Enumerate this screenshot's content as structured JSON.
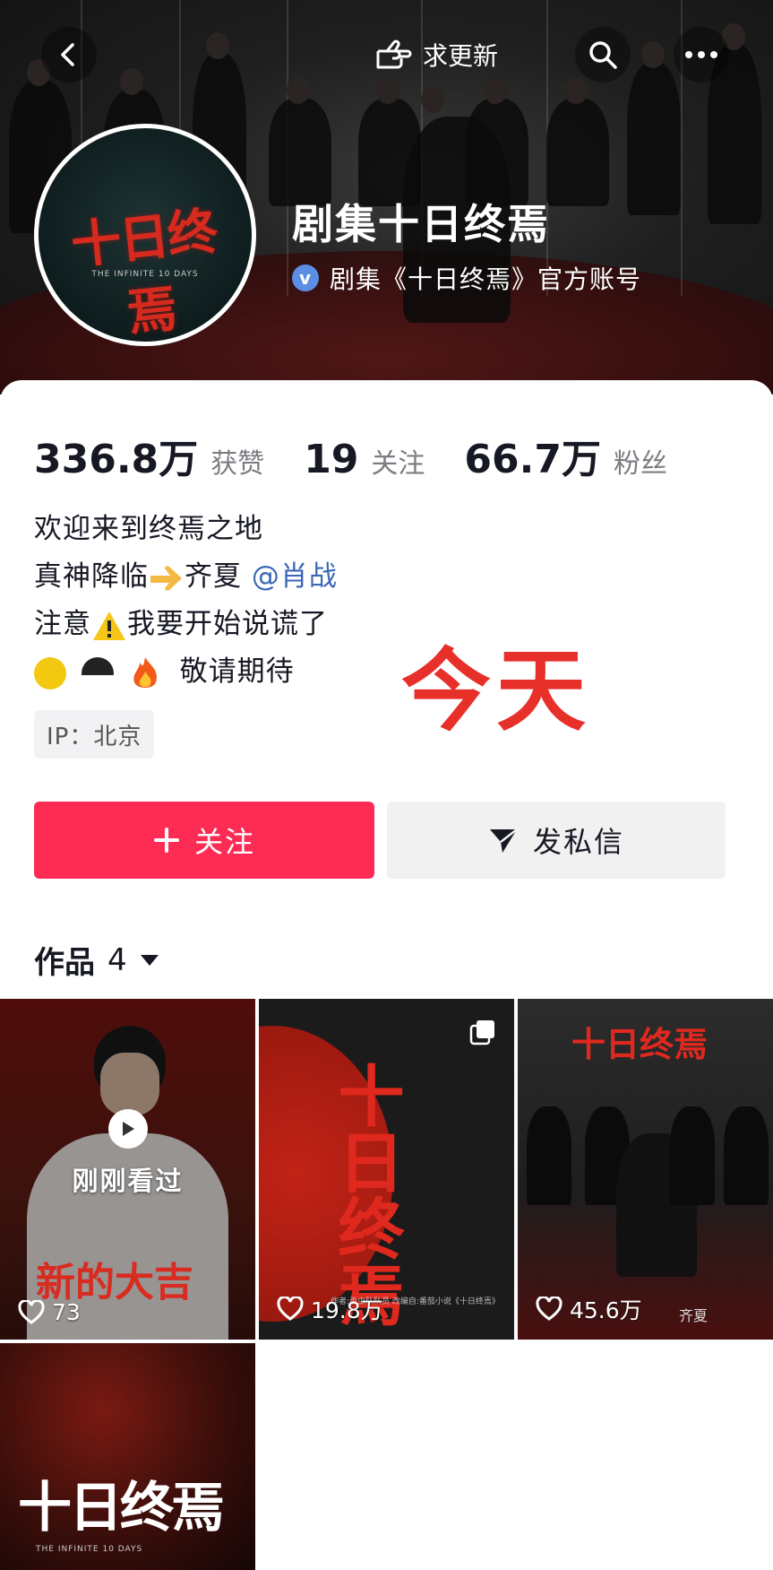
{
  "topbar": {
    "request_update_label": "求更新",
    "back_icon": "chevron-left-icon",
    "search_icon": "search-icon",
    "more_icon": "more-icon"
  },
  "profile": {
    "name": "剧集十日终焉",
    "verified_text": "剧集《十日终焉》官方账号",
    "avatar_title": "十日终焉",
    "avatar_subtitle": "THE INFINITE 10 DAYS"
  },
  "stats": [
    {
      "value": "336.8万",
      "label": "获赞"
    },
    {
      "value": "19",
      "label": "关注"
    },
    {
      "value": "66.7万",
      "label": "粉丝"
    }
  ],
  "bio": {
    "line1": "欢迎来到终焉之地",
    "line2_prefix": "真神降临",
    "line2_name": "齐夏",
    "line2_mention": "@肖战",
    "line3_prefix": "注意",
    "line3_suffix": "我要开始说谎了",
    "line4_suffix": "敬请期待"
  },
  "ip_label": "IP：北京",
  "overlay_text": "今天",
  "buttons": {
    "follow": "关注",
    "message": "发私信"
  },
  "works": {
    "tab_label": "作品",
    "count": "4",
    "tiles": [
      {
        "likes": "73",
        "badge": "刚刚看过",
        "banner": "新的大吉"
      },
      {
        "likes": "19.8万",
        "title": "十日终焉",
        "caption": "作者:杀虫队队员    改编自:番茄小说《十日终焉》"
      },
      {
        "likes": "45.6万",
        "title": "十日终焉",
        "caption": "齐夏"
      },
      {
        "title": "十日终焉",
        "subtitle": "THE INFINITE 10 DAYS"
      }
    ]
  },
  "colors": {
    "follow_button": "#fe2c55",
    "mention": "#3a66b5",
    "overlay": "#e8302a",
    "verify_badge": "#5b8fe6"
  }
}
